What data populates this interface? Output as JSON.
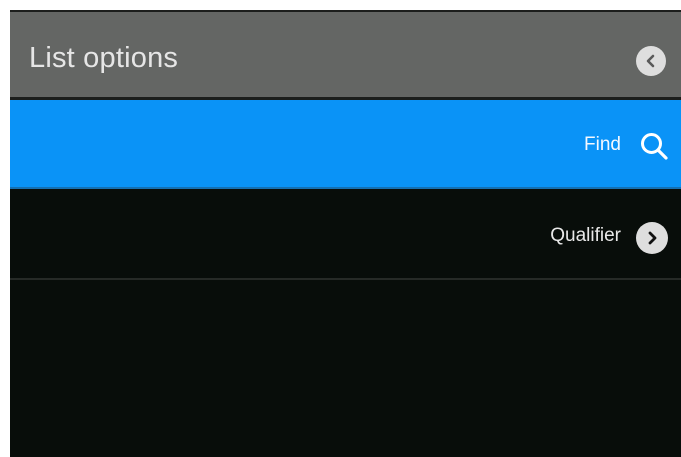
{
  "header": {
    "title": "List options",
    "back_icon": "chevron-left-circle-icon"
  },
  "menu": {
    "items": [
      {
        "label": "Find",
        "icon": "search-icon",
        "selected": true
      },
      {
        "label": "Qualifier",
        "icon": "chevron-right-circle-icon",
        "selected": false
      }
    ]
  },
  "colors": {
    "header_bg": "#646664",
    "selected_bg": "#0a93f7",
    "screen_bg": "#080d0a",
    "icon_circle": "#dedede"
  }
}
